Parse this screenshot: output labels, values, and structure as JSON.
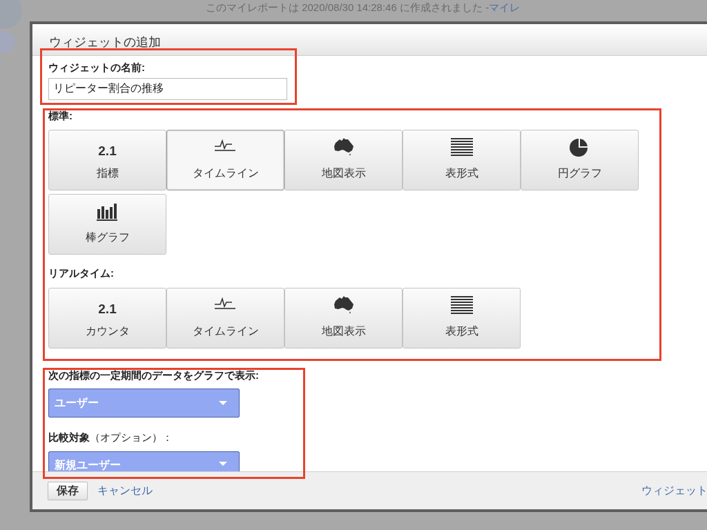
{
  "background": {
    "notice": "このマイレポートは 2020/08/30 14:28:46 に作成されました - ",
    "link": "マイレ"
  },
  "dialog": {
    "title": "ウィジェットの追加",
    "name_label": "ウィジェットの名前:",
    "name_value": "リピーター割合の推移",
    "sections": [
      {
        "label": "標準:",
        "options": [
          {
            "kind": "number",
            "icon_text": "2.1",
            "label": "指標",
            "selected": false
          },
          {
            "kind": "timeline",
            "label": "タイムライン",
            "selected": true
          },
          {
            "kind": "map",
            "label": "地図表示",
            "selected": false
          },
          {
            "kind": "table",
            "label": "表形式",
            "selected": false
          },
          {
            "kind": "pie",
            "label": "円グラフ",
            "selected": false
          },
          {
            "kind": "bar",
            "label": "棒グラフ",
            "selected": false
          }
        ]
      },
      {
        "label": "リアルタイム:",
        "options": [
          {
            "kind": "number",
            "icon_text": "2.1",
            "label": "カウンタ",
            "selected": false
          },
          {
            "kind": "timeline",
            "label": "タイムライン",
            "selected": false
          },
          {
            "kind": "map",
            "label": "地図表示",
            "selected": false
          },
          {
            "kind": "table",
            "label": "表形式",
            "selected": false
          }
        ]
      }
    ],
    "metric_label": "次の指標の一定期間のデータをグラフで表示:",
    "metric_value": "ユーザー",
    "compare_label": "**比較対象**（オプション）：",
    "compare_value": "新規ユーザー",
    "footer": {
      "save": "保存",
      "cancel": "キャンセル",
      "link": "ウィジェット"
    }
  }
}
